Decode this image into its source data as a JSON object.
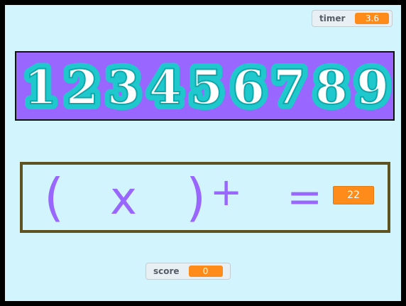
{
  "timer": {
    "label": "timer",
    "value": "3.6"
  },
  "score": {
    "label": "score",
    "value": "0"
  },
  "digits": [
    "1",
    "2",
    "3",
    "4",
    "5",
    "6",
    "7",
    "8",
    "9"
  ],
  "equation": {
    "open_paren": "(",
    "times": "x",
    "close_paren": ")",
    "plus": "+",
    "equals": "=",
    "answer": "22"
  },
  "colors": {
    "stage_bg": "#d2f5fd",
    "banner_bg": "#9966ff",
    "digit_outline": "#1fc8cc",
    "equation_border": "#5f5421",
    "symbol_color": "#9966ff",
    "monitor_value_bg": "#ff8c1a"
  }
}
